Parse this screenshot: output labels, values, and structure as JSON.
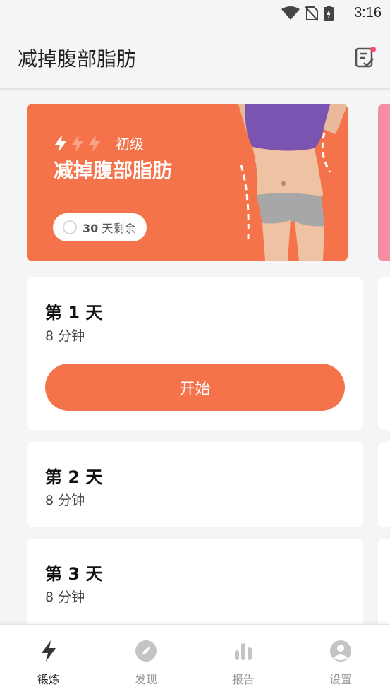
{
  "status_bar": {
    "time": "3:16"
  },
  "app_bar": {
    "title": "减掉腹部脂肪",
    "plan_icon": "checklist-icon"
  },
  "hero": {
    "level": "初级",
    "title": "减掉腹部脂肪",
    "days_number": "30",
    "days_text": "天剩余",
    "intensity_filled": 1,
    "intensity_total": 3
  },
  "days": [
    {
      "title": "第 1 天",
      "duration": "8 分钟",
      "start_label": "开始"
    },
    {
      "title": "第 2 天",
      "duration": "8 分钟"
    },
    {
      "title": "第 3 天",
      "duration": "8 分钟"
    }
  ],
  "nav": [
    {
      "label": "锻炼",
      "icon": "lightning-icon",
      "active": true
    },
    {
      "label": "发现",
      "icon": "compass-icon",
      "active": false
    },
    {
      "label": "报告",
      "icon": "bar-chart-icon",
      "active": false
    },
    {
      "label": "设置",
      "icon": "profile-icon",
      "active": false
    }
  ],
  "colors": {
    "accent": "#f5734a",
    "pink": "#f58ea3",
    "background": "#f5f5f7"
  }
}
